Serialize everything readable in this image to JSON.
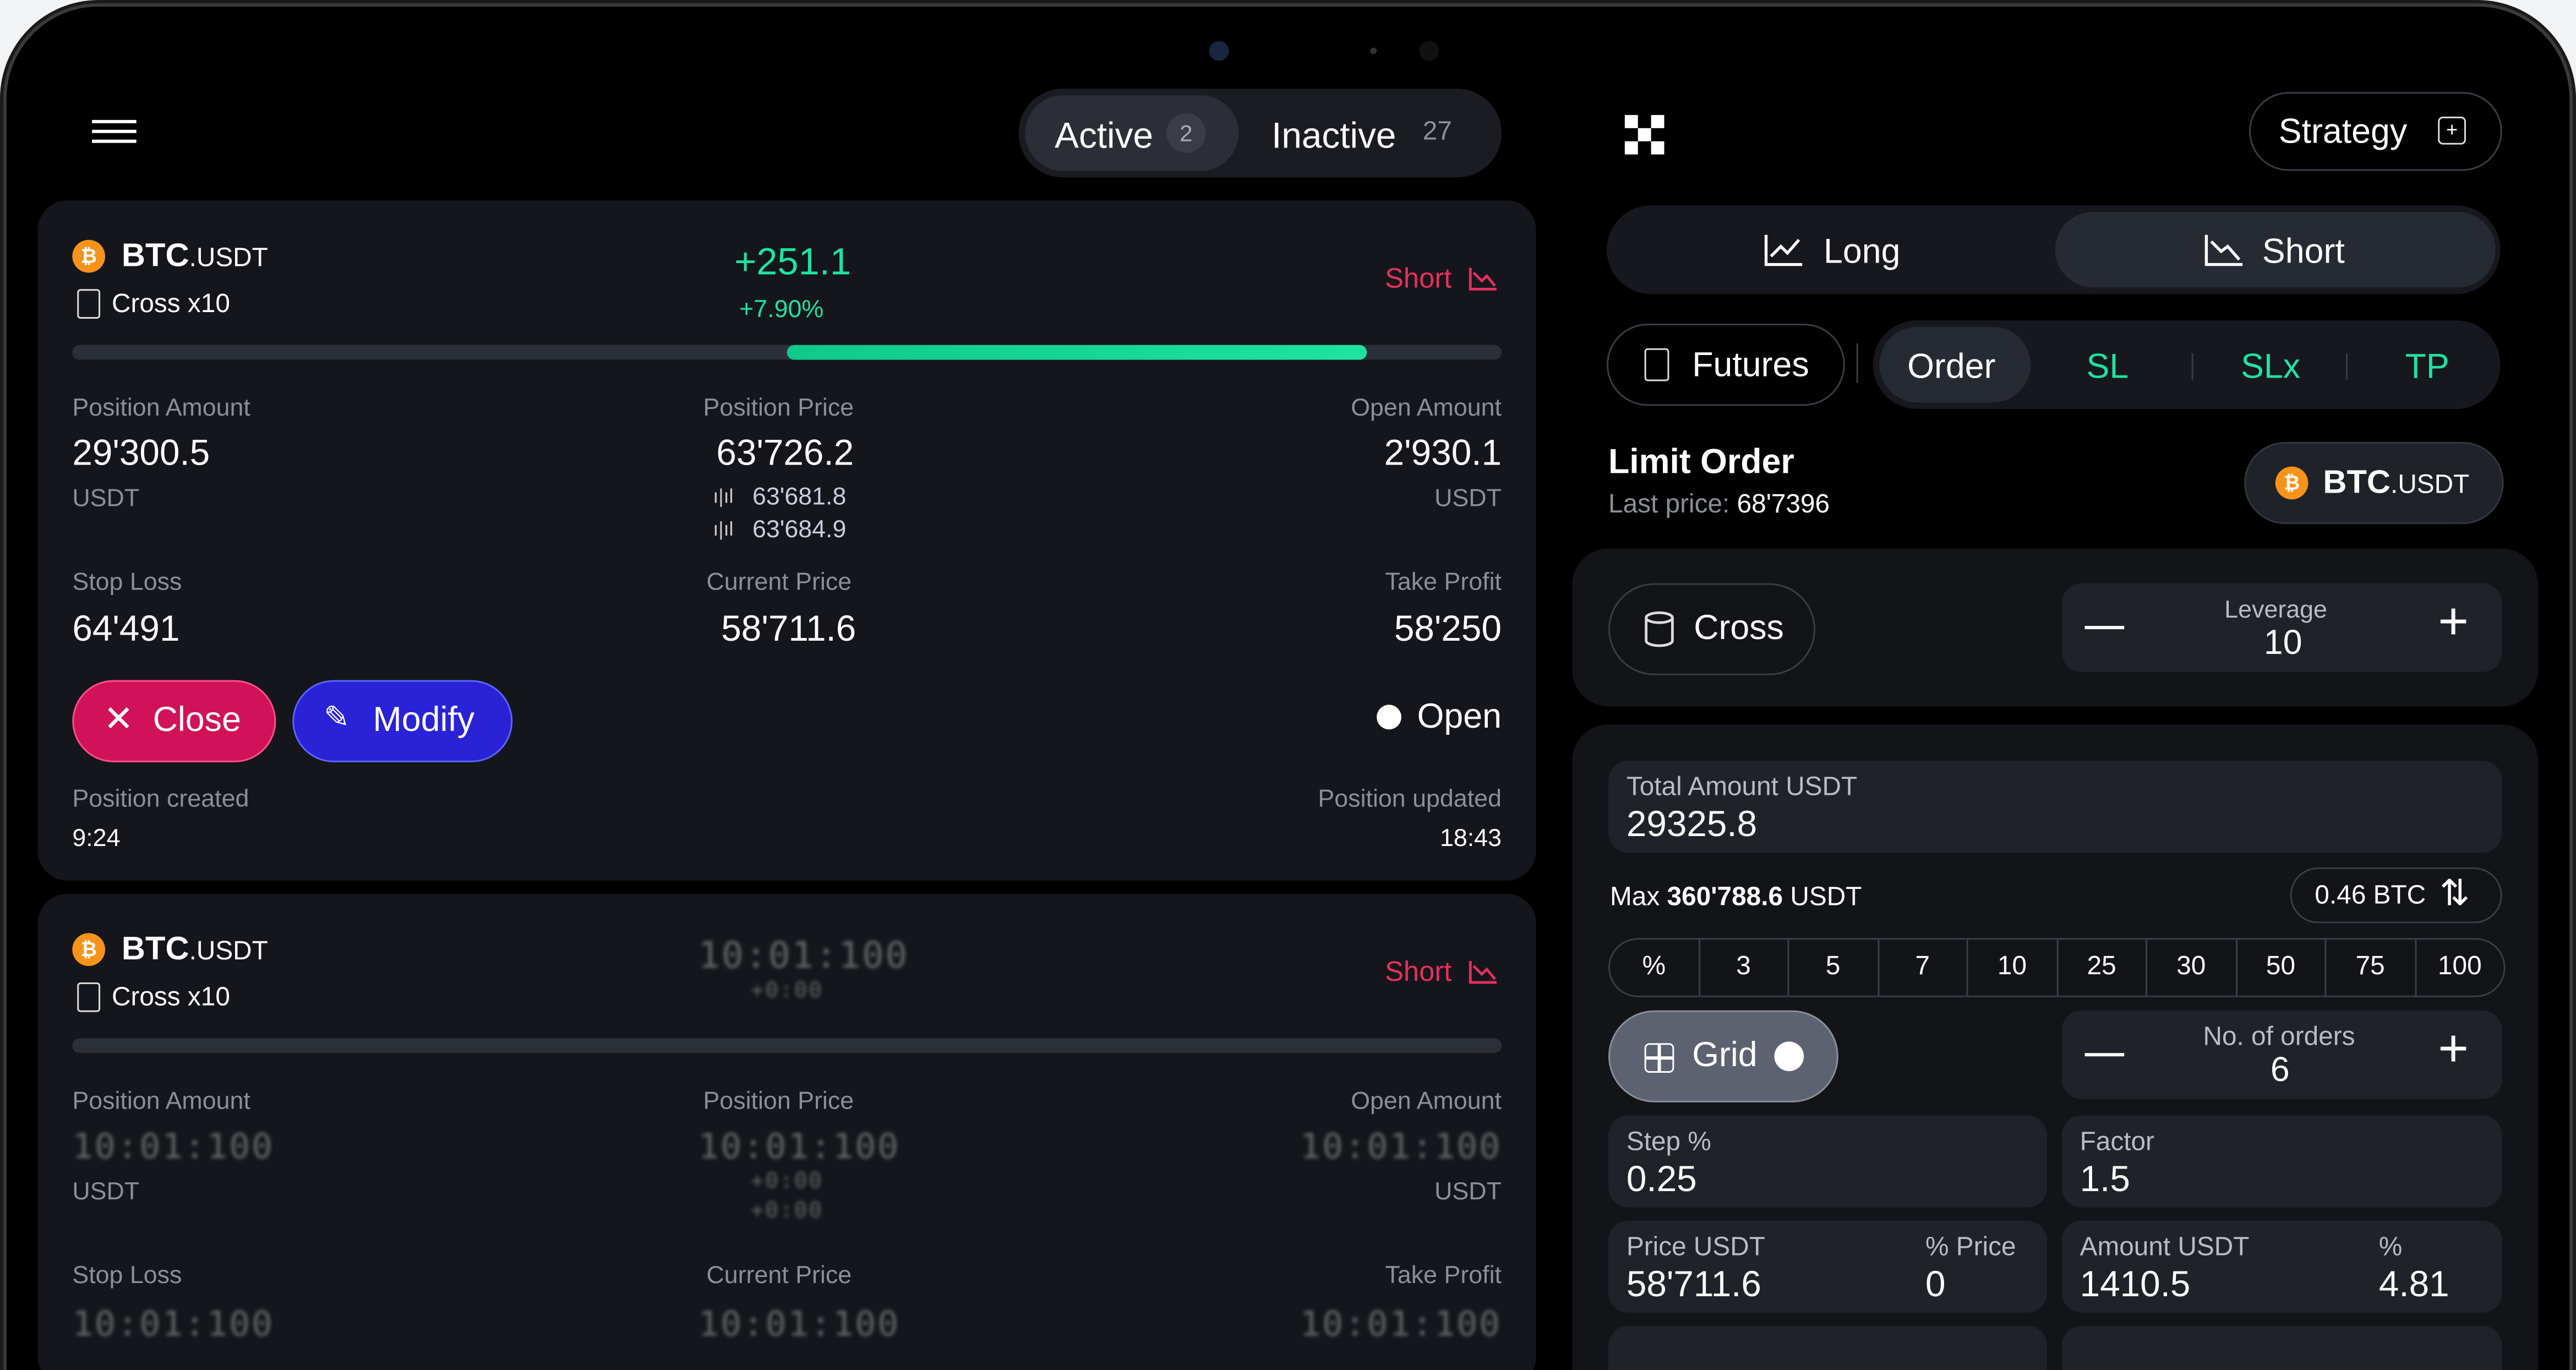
{
  "header": {
    "tabs": [
      {
        "label": "Active",
        "count": "2"
      },
      {
        "label": "Inactive",
        "count": "27"
      }
    ]
  },
  "positions": [
    {
      "symbol_base": "BTC",
      "symbol_quote": ".USDT",
      "margin": "Cross x10",
      "pnl": "+251.1",
      "pnl_pct": "+7.90%",
      "side": "Short",
      "progress": 0.4,
      "position_amount_label": "Position Amount",
      "position_amount": "29'300.5",
      "position_amount_unit": "USDT",
      "position_price_label": "Position Price",
      "position_price": "63'726.2",
      "position_price_sub1": "63'681.8",
      "position_price_sub2": "63'684.9",
      "open_amount_label": "Open Amount",
      "open_amount": "2'930.1",
      "open_amount_unit": "USDT",
      "stop_loss_label": "Stop Loss",
      "stop_loss": "64'491",
      "current_price_label": "Current Price",
      "current_price": "58'711.6",
      "take_profit_label": "Take Profit",
      "take_profit": "58'250",
      "close_label": "Close",
      "modify_label": "Modify",
      "status": "Open",
      "created_label": "Position created",
      "created": "9:24",
      "updated_label": "Position updated",
      "updated": "18:43"
    },
    {
      "symbol_base": "BTC",
      "symbol_quote": ".USDT",
      "margin": "Cross x10",
      "pnl_placeholder": "10:01:100",
      "pnl_pct_placeholder": "+0:00",
      "side": "Short",
      "position_amount_label": "Position Amount",
      "position_amount_unit": "USDT",
      "position_price_label": "Position Price",
      "open_amount_label": "Open Amount",
      "open_amount_unit": "USDT",
      "stop_loss_label": "Stop Loss",
      "current_price_label": "Current Price",
      "take_profit_label": "Take Profit",
      "placeholder": "10:01:100",
      "placeholder_small": "+0:00"
    }
  ],
  "right": {
    "strategy_label": "Strategy",
    "long_label": "Long",
    "short_label": "Short",
    "futures_label": "Futures",
    "order_tabs": [
      "Order",
      "SL",
      "SLx",
      "TP"
    ],
    "order_title": "Limit Order",
    "last_price_label": "Last price:",
    "last_price": "68'7396",
    "pair_base": "BTC",
    "pair_quote": ".USDT",
    "cross_label": "Cross",
    "leverage_label": "Leverage",
    "leverage": "10",
    "total_amount_label": "Total Amount USDT",
    "total_amount": "29325.8",
    "max_prefix": "Max",
    "max_value": "360'788.6",
    "max_unit": "USDT",
    "btc_amount": "0.46 BTC",
    "pct_options": [
      "%",
      "3",
      "5",
      "7",
      "10",
      "25",
      "30",
      "50",
      "75",
      "100"
    ],
    "grid_label": "Grid",
    "orders_label": "No. of orders",
    "orders": "6",
    "step_label": "Step %",
    "step": "0.25",
    "factor_label": "Factor",
    "factor": "1.5",
    "price_label": "Price USDT",
    "price": "58'711.6",
    "pct_price_label": "% Price",
    "pct_price": "0",
    "amount_label": "Amount USDT",
    "amount": "1410.5",
    "amount_pct_label": "%",
    "amount_pct": "4.81"
  },
  "colors": {
    "green": "#1ee3a0",
    "short_red": "#e5305e",
    "close_btn": "#d11258",
    "modify_btn": "#2a22d6"
  }
}
